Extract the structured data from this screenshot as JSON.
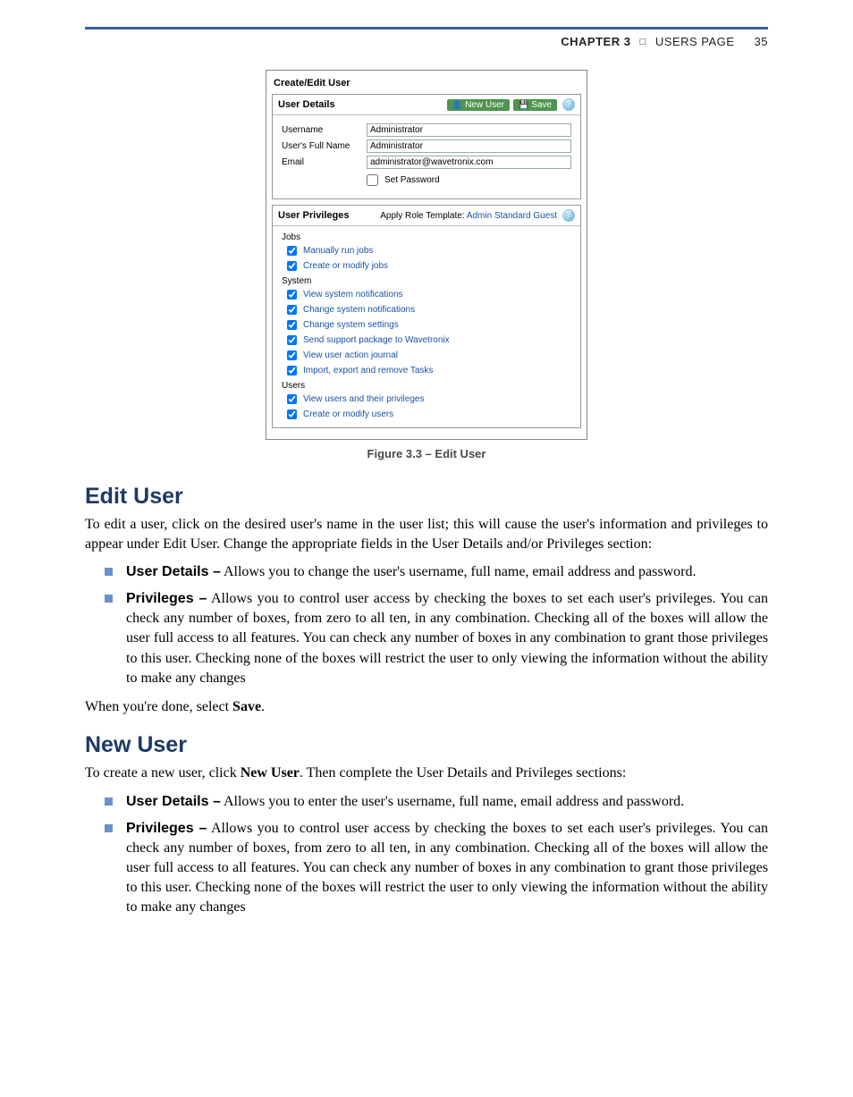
{
  "header": {
    "chapter": "CHAPTER 3",
    "section": "USERS PAGE",
    "page_num": "35"
  },
  "figure": {
    "panel_title": "Create/Edit User",
    "user_details": {
      "heading": "User Details",
      "new_user_btn": "New User",
      "save_btn": "Save",
      "fields": {
        "username_label": "Username",
        "username_value": "Administrator",
        "fullname_label": "User's Full Name",
        "fullname_value": "Administrator",
        "email_label": "Email",
        "email_value": "administrator@wavetronix.com",
        "set_password_label": "Set Password"
      }
    },
    "user_privileges": {
      "heading": "User Privileges",
      "apply_label": "Apply Role Template:",
      "roles": {
        "admin": "Admin",
        "standard": "Standard",
        "guest": "Guest"
      },
      "groups": [
        {
          "title": "Jobs",
          "items": [
            "Manually run jobs",
            "Create or modify jobs"
          ]
        },
        {
          "title": "System",
          "items": [
            "View system notifications",
            "Change system notifications",
            "Change system settings",
            "Send support package to Wavetronix",
            "View user action journal",
            "Import, export and remove Tasks"
          ]
        },
        {
          "title": "Users",
          "items": [
            "View users and their privileges",
            "Create or modify users"
          ]
        }
      ]
    },
    "caption": "Figure 3.3 – Edit User"
  },
  "sections": {
    "edit_user": {
      "heading": "Edit User",
      "intro": "To edit a user, click on the desired user's name in the user list; this will cause the user's information and privileges to appear under Edit User. Change the appropriate fields in the User Details and/or Privileges section:",
      "bullets": [
        {
          "term": "User Details –",
          "text": " Allows you to change the user's username, full name, email address and password."
        },
        {
          "term": "Privileges –",
          "text": " Allows you to control user access by checking the boxes to set each user's privileges. You can check any number of boxes, from zero to all ten, in any combination. Checking all of the boxes will allow the user full access to all features. You can check any number of boxes in any combination to grant those privileges to this user. Checking none of the boxes will restrict the user to only viewing the information without the ability to make any changes"
        }
      ],
      "outro_pre": "When you're done, select ",
      "outro_bold": "Save",
      "outro_post": "."
    },
    "new_user": {
      "heading": "New User",
      "intro_pre": "To create a new user, click ",
      "intro_bold": "New User",
      "intro_post": ". Then complete the User Details and Privileges sections:",
      "bullets": [
        {
          "term": "User Details –",
          "text": " Allows you to enter the user's username, full name, email address and password."
        },
        {
          "term": "Privileges –",
          "text": " Allows you to control user access by checking the boxes to set each user's privileges. You can check any number of boxes, from zero to all ten, in any combination. Checking all of the boxes will allow the user full access to all features. You can check any number of boxes in any combination to grant those privileges to this user. Checking none of the boxes will restrict the user to only viewing the information without the ability to make any changes"
        }
      ]
    }
  }
}
